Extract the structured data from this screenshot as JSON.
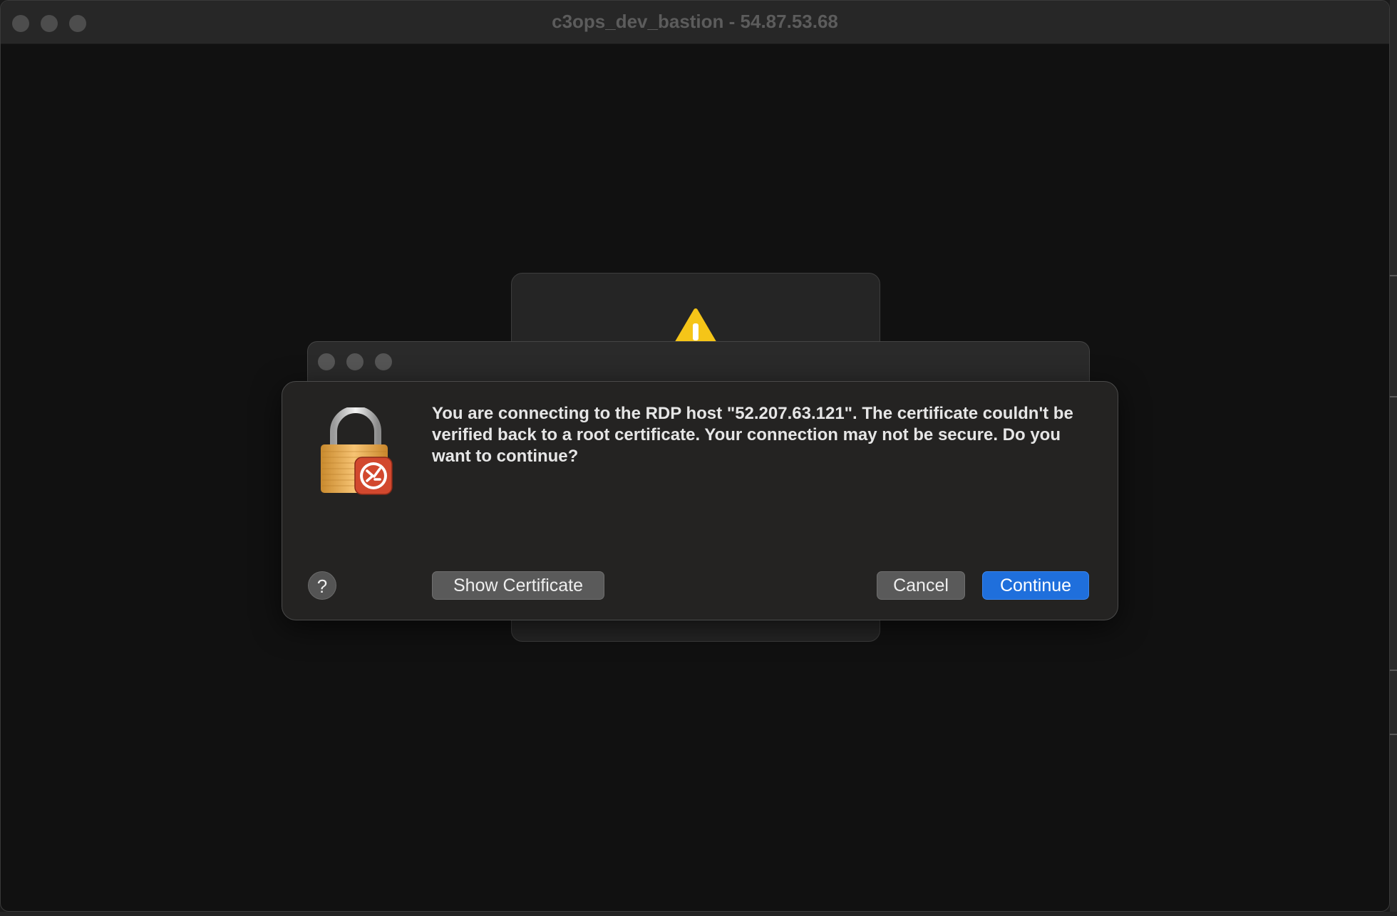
{
  "window": {
    "title": "c3ops_dev_bastion - 54.87.53.68"
  },
  "dialog": {
    "message": "You are connecting to the RDP host \"52.207.63.121\". The certificate couldn't be verified back to a root certificate. Your connection may not be secure. Do you want to continue?",
    "help_label": "?",
    "show_certificate_label": "Show Certificate",
    "cancel_label": "Cancel",
    "continue_label": "Continue"
  },
  "colors": {
    "accent": "#1f6fdc",
    "background": "#111111",
    "dialog_background": "#242322"
  },
  "icons": {
    "dialog_icon": "lock-rdp-icon",
    "back_alert_icon": "warning-icon"
  }
}
